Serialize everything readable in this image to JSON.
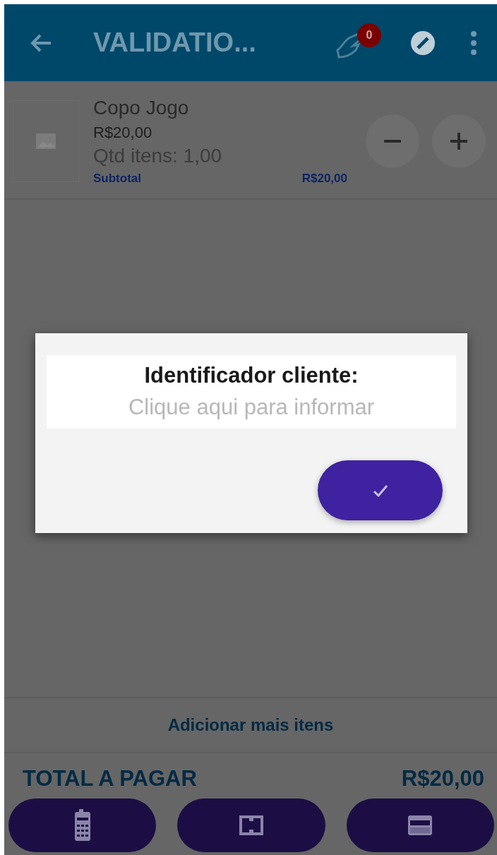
{
  "app_bar": {
    "title": "VALIDATIO...",
    "badge": "0"
  },
  "cart_items": [
    {
      "name": "Copo Jogo",
      "price": "R$20,00",
      "quantity": "Qtd itens: 1,00",
      "subtotal_label": "Subtotal",
      "subtotal": "R$20,00"
    }
  ],
  "add_more": "Adicionar mais itens",
  "total": {
    "label": "TOTAL A PAGAR",
    "value": "R$20,00"
  },
  "payment_buttons": [
    {
      "kind": "terminal"
    },
    {
      "kind": "cash"
    },
    {
      "kind": "card"
    }
  ],
  "dialog": {
    "title": "Identificador cliente:",
    "placeholder": "Clique aqui para informar"
  }
}
